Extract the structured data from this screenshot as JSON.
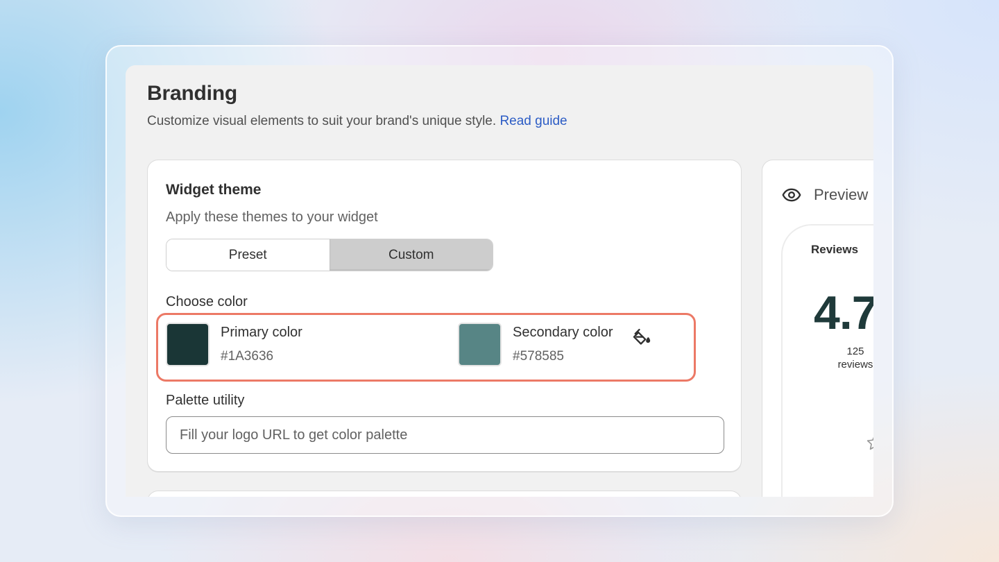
{
  "header": {
    "title": "Branding",
    "subtitle": "Customize visual elements to suit your brand's unique style.",
    "guide_link": "Read guide"
  },
  "widget_theme": {
    "title": "Widget theme",
    "subtitle": "Apply these themes to your widget",
    "tabs": [
      {
        "label": "Preset",
        "active": false
      },
      {
        "label": "Custom",
        "active": true
      }
    ],
    "choose_color_label": "Choose color",
    "primary": {
      "name": "Primary color",
      "value": "#1A3636"
    },
    "secondary": {
      "name": "Secondary color",
      "value": "#578585"
    },
    "palette_label": "Palette utility",
    "palette_placeholder": "Fill your logo URL to get color palette"
  },
  "preview": {
    "label": "Preview",
    "reviews_title": "Reviews",
    "rating": "4.7",
    "count_number": "125",
    "count_label": "reviews"
  },
  "colors": {
    "highlight": "#EC7966",
    "link": "#2C5CC5",
    "swatch_primary": "#1A3636",
    "swatch_secondary": "#578585"
  },
  "icons": [
    "paint-bucket-icon",
    "eye-icon",
    "star-icon"
  ]
}
